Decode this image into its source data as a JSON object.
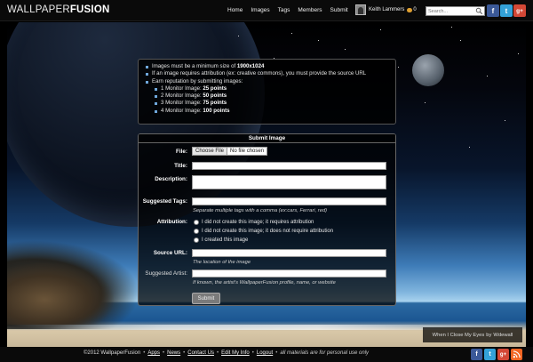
{
  "header": {
    "logo_light": "WALLPAPER",
    "logo_bold": "FUSION",
    "nav": [
      "Home",
      "Images",
      "Tags",
      "Members",
      "Submit"
    ],
    "user_name": "Keith Lammers",
    "coin_count": "0",
    "search_placeholder": "Search..."
  },
  "social": {
    "facebook": "f",
    "twitter": "t",
    "googleplus": "g+",
    "rss": "rss"
  },
  "info": {
    "line1_prefix": "Images must be a minimum size of ",
    "line1_value": "1900x1024",
    "line2": "If an image requires attribution (ex: creative commons), you must provide the source URL",
    "line3": "Earn reputation by submitting images:",
    "tiers": [
      {
        "label": "1 Monitor Image: ",
        "points": "25 points"
      },
      {
        "label": "2 Monitor Image: ",
        "points": "50 points"
      },
      {
        "label": "3 Monitor Image: ",
        "points": "75 points"
      },
      {
        "label": "4 Monitor Image: ",
        "points": "100 points"
      }
    ]
  },
  "form": {
    "title": "Submit Image",
    "file_label": "File:",
    "file_button": "Choose File",
    "file_status": "No file chosen",
    "title_label": "Title:",
    "description_label": "Description:",
    "tags_label": "Suggested Tags:",
    "tags_hint": "Separate multiple tags with a comma (ex:cars, Ferrari, red)",
    "attribution_label": "Attribution:",
    "attribution_options": [
      "I did not create this image; it requires attribution",
      "I did not create this image; it does not require attribution",
      "I created this image"
    ],
    "source_label": "Source URL:",
    "source_hint": "The location of the image",
    "artist_label": "Suggested Artist:",
    "artist_hint": "If known, the artist's WallpaperFusion profile, name, or website",
    "submit": "Submit"
  },
  "credit": {
    "title": "When I Close My Eyes",
    "by": "by",
    "author": "Wdewall"
  },
  "footer": {
    "copyright": "©2012 WallpaperFusion",
    "links": [
      "Apps",
      "News",
      "Contact Us",
      "Edit My Info",
      "Logout"
    ],
    "note": "all materials are for personal use only"
  },
  "colors": {
    "facebook": "#3b5998",
    "twitter": "#33a1d8",
    "googleplus": "#d34836",
    "rss": "#f26522",
    "bullet": "#6fa8dc"
  }
}
